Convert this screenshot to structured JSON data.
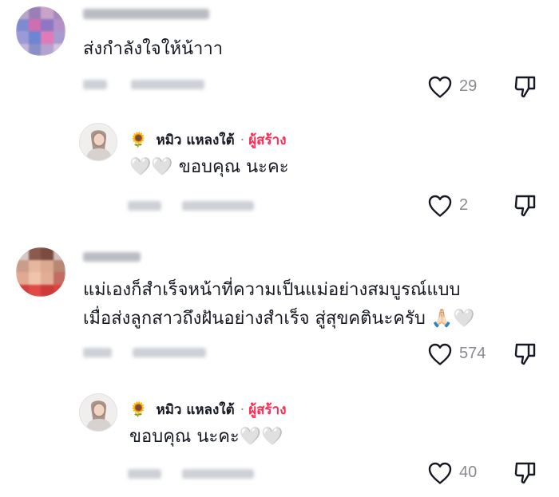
{
  "comments": [
    {
      "text": "ส่งกำลังใจให้น้าาา",
      "likes": "29",
      "reply": {
        "emoji": "🌻",
        "author": "หมิว แหลงใต้",
        "separator": "·",
        "badge": "ผู้สร้าง",
        "text": "🤍🤍 ขอบคุณ นะคะ",
        "likes": "2"
      }
    },
    {
      "text_line1": "แม่เองก็สำเร็จหน้าที่ความเป็นแม่อย่างสมบูรณ์แบบ",
      "text_line2": "เมื่อส่งลูกสาวถึงฝันอย่างสำเร็จ สู่สุขคตินะครับ 🙏🏻🤍",
      "likes": "574",
      "reply": {
        "emoji": "🌻",
        "author": "หมิว แหลงใต้",
        "separator": "·",
        "badge": "ผู้สร้าง",
        "text": "ขอบคุณ นะคะ🤍🤍",
        "likes": "40"
      }
    }
  ],
  "icons": {
    "like": "heart-outline-icon",
    "dislike": "thumbs-down-icon"
  },
  "colors": {
    "creator_badge": "#fe2c55",
    "muted": "#8a8b91",
    "text": "#161823"
  }
}
